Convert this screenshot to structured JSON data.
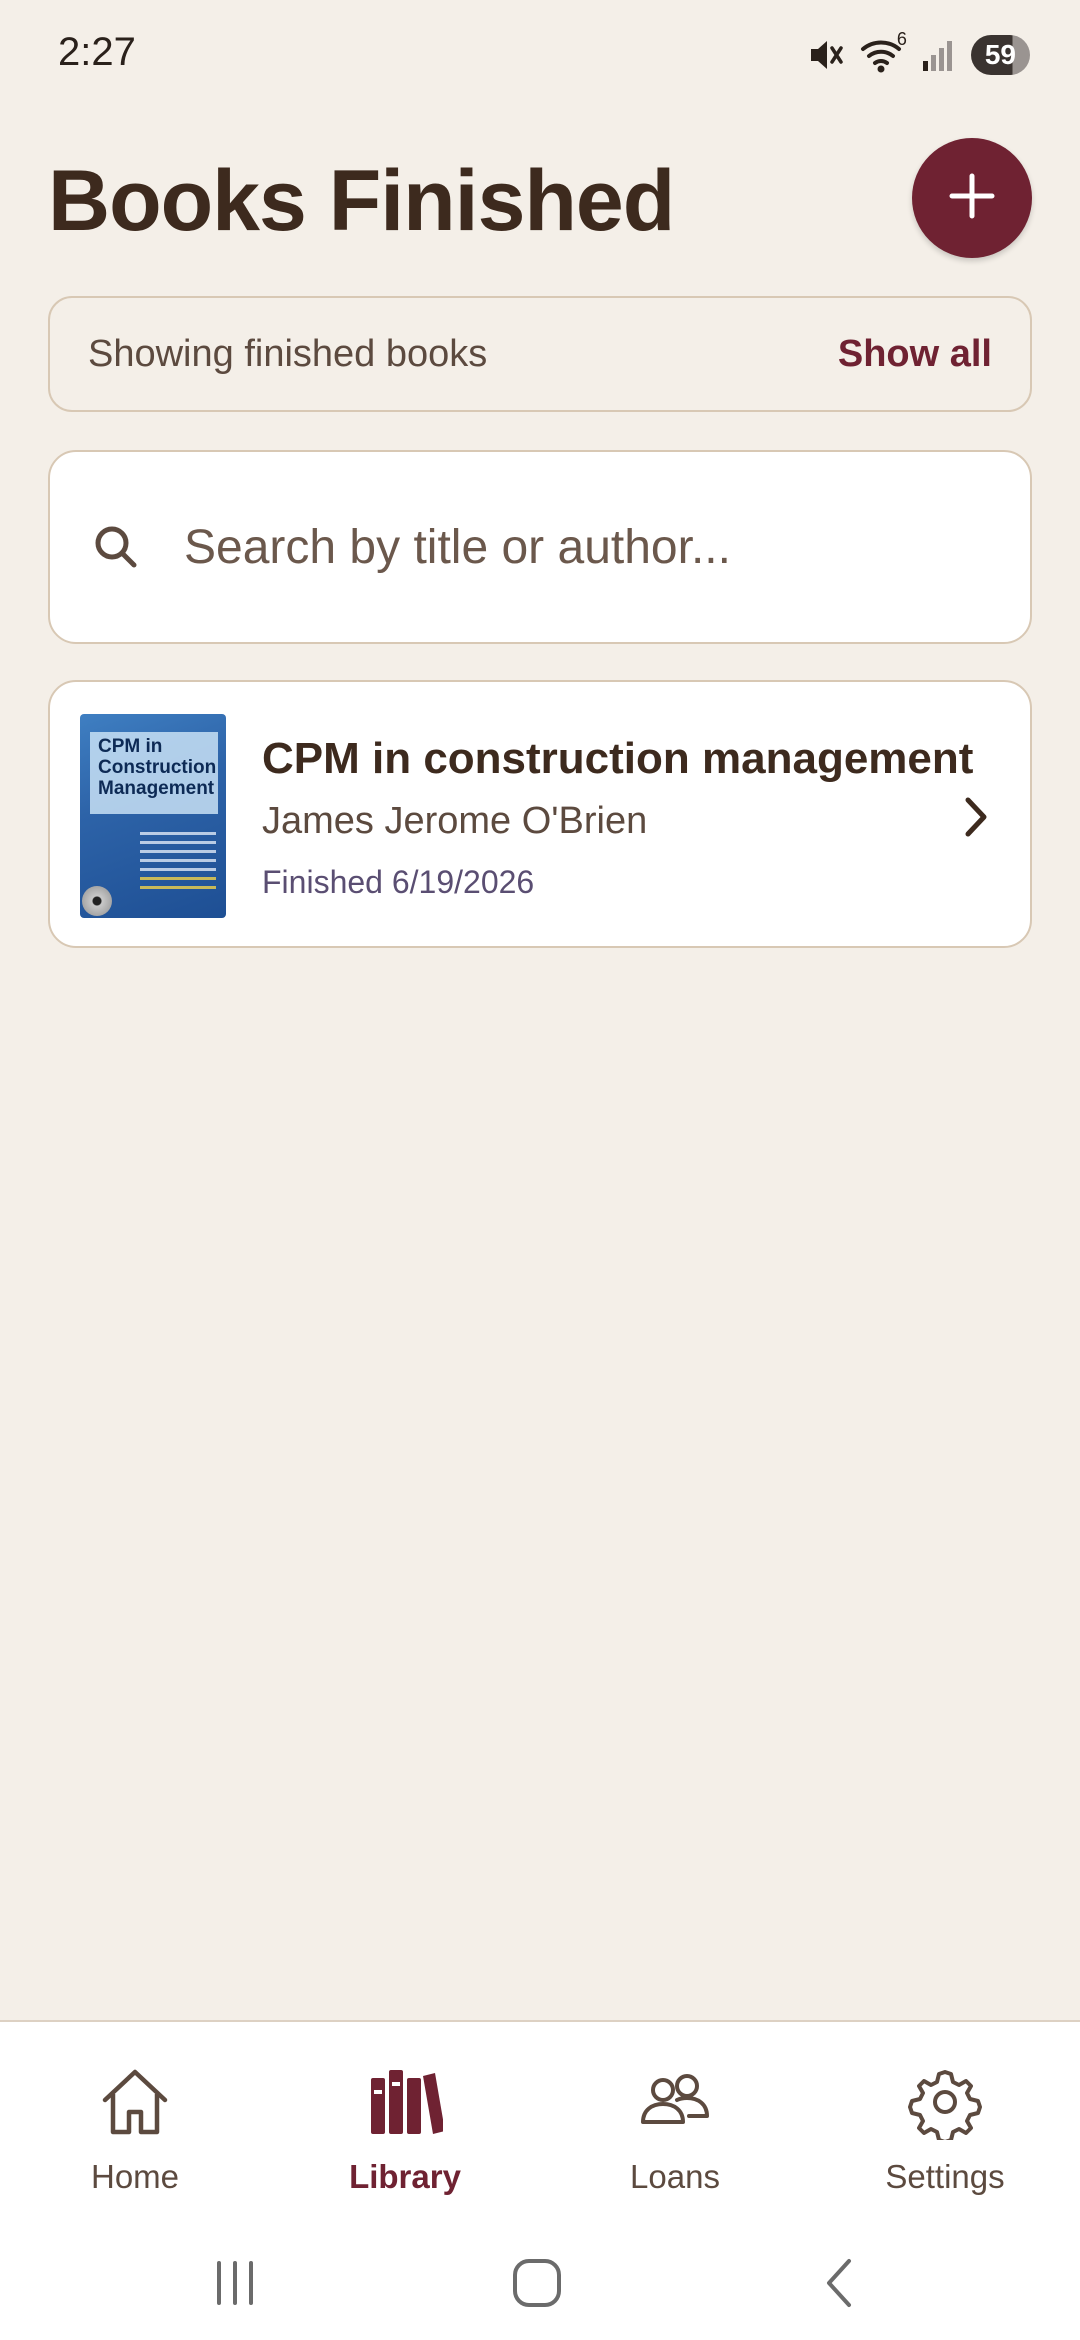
{
  "status_bar": {
    "time": "2:27",
    "wifi_label": "6",
    "battery": "59"
  },
  "header": {
    "title": "Books Finished",
    "add_icon": "plus-icon"
  },
  "filter": {
    "text": "Showing finished books",
    "action_label": "Show all"
  },
  "search": {
    "placeholder": "Search by title or author...",
    "value": "",
    "icon": "search-icon"
  },
  "books": [
    {
      "title": "CPM in construction management",
      "author": "James Jerome O'Brien",
      "finished": "Finished 6/19/2026",
      "cover_title": "CPM in Construction Management"
    }
  ],
  "bottom_nav": {
    "items": [
      {
        "label": "Home",
        "icon": "home-icon",
        "active": false
      },
      {
        "label": "Library",
        "icon": "library-icon",
        "active": true
      },
      {
        "label": "Loans",
        "icon": "people-icon",
        "active": false
      },
      {
        "label": "Settings",
        "icon": "gear-icon",
        "active": false
      }
    ]
  },
  "colors": {
    "background": "#f4efe8",
    "accent": "#6f2232",
    "text_primary": "#3d2a1e",
    "text_secondary": "#5c4a3f",
    "finished_text": "#5a4e72",
    "border": "#d8c8b4"
  }
}
